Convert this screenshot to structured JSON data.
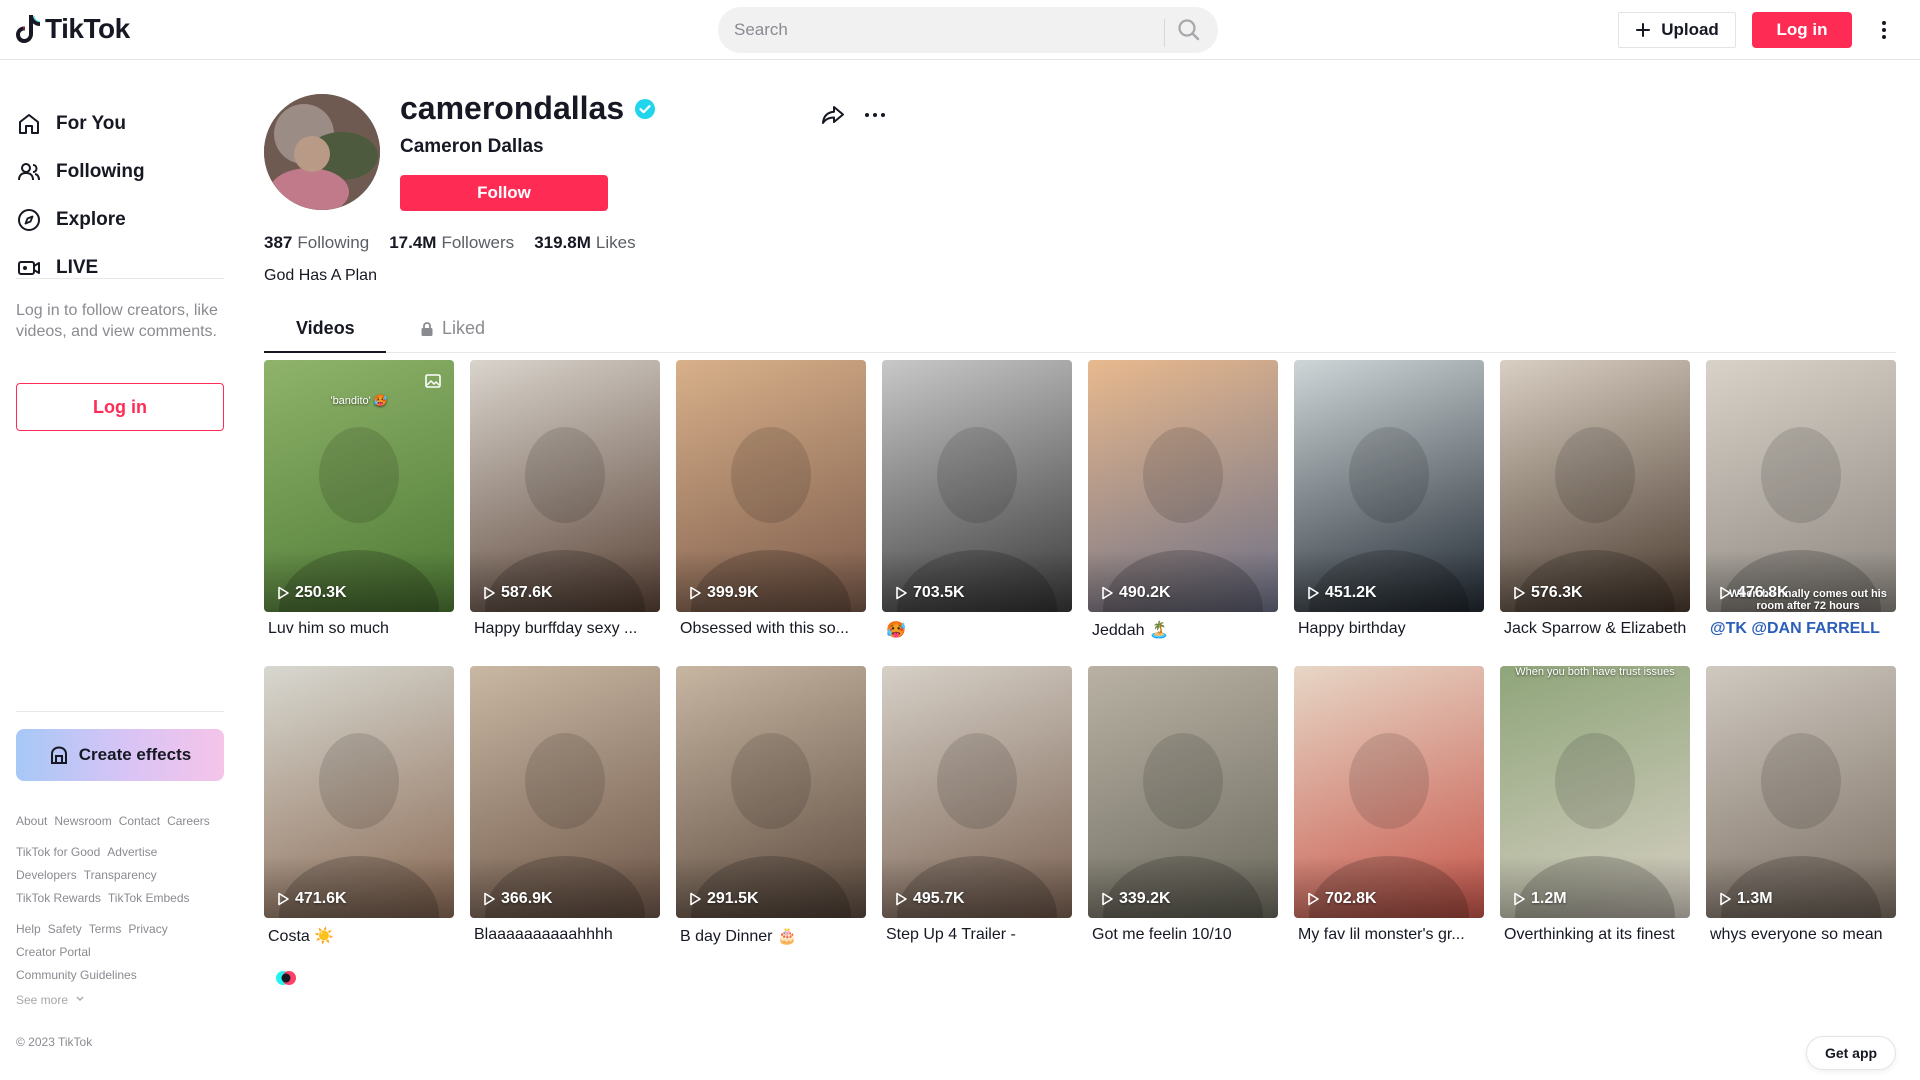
{
  "header": {
    "logo_text": "TikTok",
    "search_placeholder": "Search",
    "upload_label": "Upload",
    "login_label": "Log in"
  },
  "sidebar": {
    "nav": [
      {
        "label": "For You",
        "icon": "home-icon"
      },
      {
        "label": "Following",
        "icon": "users-icon"
      },
      {
        "label": "Explore",
        "icon": "compass-icon"
      },
      {
        "label": "LIVE",
        "icon": "live-icon"
      }
    ],
    "login_prompt": "Log in to follow creators, like videos, and view comments.",
    "login_label": "Log in",
    "create_effects_label": "Create effects",
    "footer_rows": [
      [
        "About",
        "Newsroom",
        "Contact",
        "Careers"
      ],
      [
        "TikTok for Good",
        "Advertise"
      ],
      [
        "Developers",
        "Transparency"
      ],
      [
        "TikTok Rewards",
        "TikTok Embeds"
      ],
      [
        "Help",
        "Safety",
        "Terms",
        "Privacy"
      ],
      [
        "Creator Portal"
      ],
      [
        "Community Guidelines"
      ]
    ],
    "see_more": "See more",
    "copyright": "© 2023 TikTok"
  },
  "profile": {
    "username": "camerondallas",
    "display_name": "Cameron Dallas",
    "follow_label": "Follow",
    "following_count": "387",
    "following_label": "Following",
    "followers_count": "17.4M",
    "followers_label": "Followers",
    "likes_count": "319.8M",
    "likes_label": "Likes",
    "bio": "God Has A Plan",
    "tabs": {
      "videos": "Videos",
      "liked": "Liked"
    }
  },
  "videos": [
    {
      "views": "250.3K",
      "caption": "Luv him so much",
      "overlay": "'bandito' 🥵",
      "colors": [
        "#8fb36a",
        "#4e7a35"
      ]
    },
    {
      "views": "587.6K",
      "caption": "Happy burffday sexy ...",
      "overlay": "",
      "colors": [
        "#d9d4cc",
        "#5a4337"
      ]
    },
    {
      "views": "399.9K",
      "caption": "Obsessed with this so...",
      "overlay": "",
      "colors": [
        "#d8b08a",
        "#7a5a4a"
      ]
    },
    {
      "views": "703.5K",
      "caption": "🥵",
      "overlay": "",
      "colors": [
        "#c8c8c8",
        "#3a3a3a"
      ]
    },
    {
      "views": "490.2K",
      "caption": "Jeddah 🏝️",
      "overlay": "",
      "colors": [
        "#e8b98e",
        "#6c6f86"
      ]
    },
    {
      "views": "451.2K",
      "caption": "Happy birthday",
      "overlay": "",
      "colors": [
        "#cfd6d8",
        "#222a33"
      ]
    },
    {
      "views": "576.3K",
      "caption": "Jack Sparrow & Elizabeth",
      "overlay": "",
      "colors": [
        "#d9cfc2",
        "#4a3a2e"
      ]
    },
    {
      "views": "476.8K",
      "caption": "@TK @DAN FARRELL",
      "overlay": "When he finally comes out his room after 72 hours",
      "colors": [
        "#d8d2c8",
        "#8c8680"
      ]
    },
    {
      "views": "471.6K",
      "caption": "Costa ☀️",
      "overlay": "",
      "colors": [
        "#d8d8d0",
        "#8a6a55"
      ]
    },
    {
      "views": "366.9K",
      "caption": "Blaaaaaaaaaahhhh",
      "overlay": "",
      "colors": [
        "#c9b8a4",
        "#6e5648"
      ]
    },
    {
      "views": "291.5K",
      "caption": "B day Dinner 🎂",
      "overlay": "",
      "colors": [
        "#c7b6a2",
        "#5c4a3e"
      ]
    },
    {
      "views": "495.7K",
      "caption": "Step Up 4 Trailer -",
      "overlay": "",
      "colors": [
        "#d6d0c7",
        "#7a6152"
      ]
    },
    {
      "views": "339.2K",
      "caption": "Got me feelin 10/10",
      "overlay": "",
      "colors": [
        "#b9b2a4",
        "#6c6a5e"
      ]
    },
    {
      "views": "702.8K",
      "caption": "My fav lil monster's gr...",
      "overlay": "",
      "colors": [
        "#e7d6c6",
        "#c7564a"
      ]
    },
    {
      "views": "1.2M",
      "caption": "Overthinking at its finest",
      "overlay": "When you both have trust issues",
      "colors": [
        "#8fa57a",
        "#d6cfc3"
      ]
    },
    {
      "views": "1.3M",
      "caption": "whys everyone so mean",
      "overlay": "",
      "colors": [
        "#cfc9c0",
        "#7b6e62"
      ]
    }
  ],
  "get_app_label": "Get app",
  "colors": {
    "brand": "#fe2c55",
    "verified": "#20d5ec",
    "link": "#2b5db9"
  }
}
